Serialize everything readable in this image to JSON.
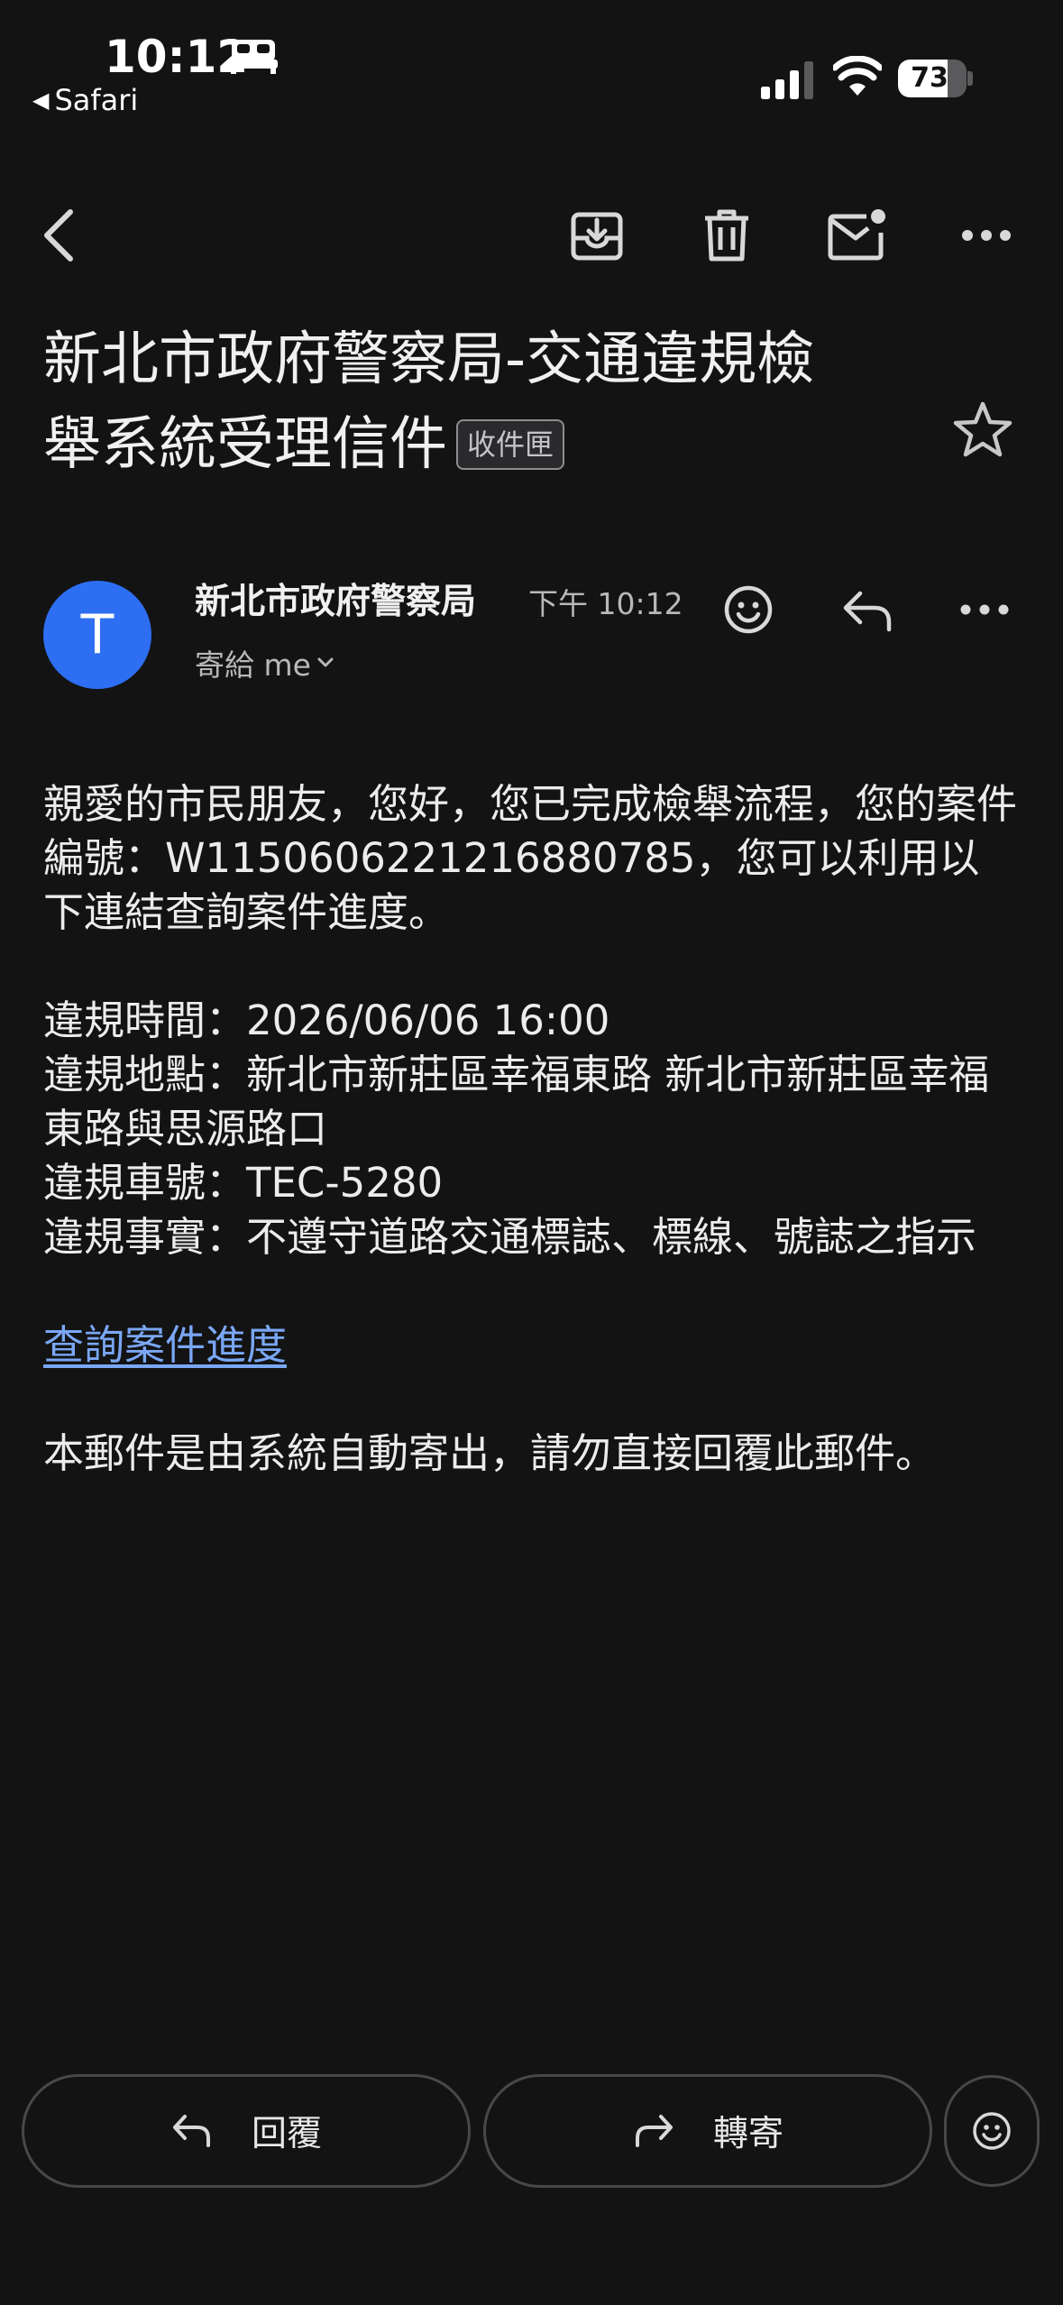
{
  "status_bar": {
    "time": "10:12",
    "back_app": "Safari",
    "battery": "73",
    "battery_level": 0.73
  },
  "email": {
    "subject_line1": "新北市政府警察局-交通違規檢",
    "subject_line2": "舉系統受理信件",
    "label": "收件匣",
    "sender_initial": "T",
    "sender_name": "新北市政府警察局",
    "time": "下午 10:12",
    "recipient": "寄給 me",
    "body": {
      "intro": "親愛的市民朋友，您好，您已完成檢舉流程，您的案件編號：W1150606221216880785，您可以利用以下連結查詢案件進度。",
      "time_line": "違規時間：2026/06/06 16:00",
      "location_line": "違規地點：新北市新莊區幸福東路 新北市新莊區幸福東路與思源路口",
      "plate_line": "違規車號：TEC-5280",
      "fact_line": "違規事實：不遵守道路交通標誌、標線、號誌之指示",
      "link_text": "查詢案件進度",
      "footer": "本郵件是由系統自動寄出，請勿直接回覆此郵件。"
    }
  },
  "actions": {
    "reply_label": "回覆",
    "forward_label": "轉寄"
  },
  "colors": {
    "background": "#131314",
    "avatar": "#2d6ef2",
    "link": "#7aa7f5"
  }
}
